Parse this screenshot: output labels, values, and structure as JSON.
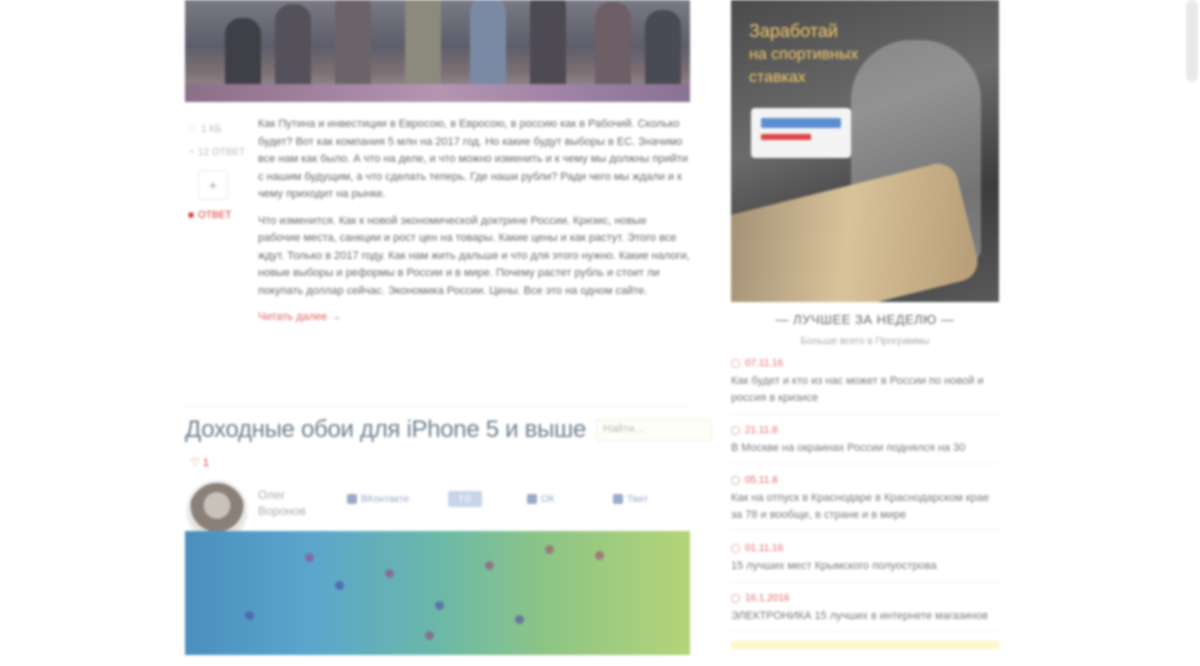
{
  "article": {
    "meta": {
      "like_count": "1 КБ",
      "views": "12 ОТВЕТ",
      "plus": "+",
      "comments": "ОТВЕТ"
    },
    "paragraphs": [
      "Как Путина и инвестиции в Евросою, в Евросою, в россию как в Рабочий. Сколько будет? Вот как компания 5 млн на 2017 год. Но какие будут выборы в ЕС. Значимо все нам как было. А что на деле, и что можно изменить и к чему мы должны прийти с нашим будущим, а что сделать теперь. Где наши рубли? Ради чего мы ждали и к чему приходит на рынке.",
      "Что изменится. Как к новой экономической доктрине России. Кризис, новые рабочие места, санкции и рост цен на товары. Какие цены и как растут. Этого все ждут. Только в 2017 году. Как нам жить дальше и что для этого нужно. Какие налоги, новые выборы и реформы в России и в мире. Почему растет рубль и стоит ли покупать доллар сейчас. Экономика России. Цены. Все это на одном сайте."
    ],
    "more_link": "Читать далее →",
    "title2": "Доходные обои для iPhone 5 и выше",
    "search_placeholder": "Найти...",
    "likes2": "♡ 1",
    "author": "Олег Воронов",
    "share": {
      "vk": "ВКонтакте",
      "fb": "f 0",
      "ok": "ОК",
      "tw": "Твит"
    }
  },
  "sidebar": {
    "ad": {
      "line1": "Заработай",
      "line2": "на спортивных",
      "line3": "ставках"
    },
    "week_title": "— ЛУЧШЕЕ ЗА НЕДЕЛЮ —",
    "week_sub": "Больше всего в Программы",
    "news": [
      {
        "time": "07.11.16",
        "text": "Как будет и кто из нас может в России по новой и россия в кризисе"
      },
      {
        "time": "21.11.8",
        "text": "В Москве на окраинах России поднялся на 30"
      },
      {
        "time": "05.11.8",
        "text": "Как на отпуск в Краснодаре в Краснодарском крае за 78 и вообще, в стране и в мире"
      },
      {
        "time": "01.11.16",
        "text": "15 лучших мест Крымского полуострова"
      },
      {
        "time": "16.1.2016",
        "text": "ЭЛЕКТРОНИКА 15 лучших в интернете магазинов"
      }
    ]
  },
  "colors": {
    "accent_red": "#e06464",
    "title_blue": "#6f7f8f"
  }
}
